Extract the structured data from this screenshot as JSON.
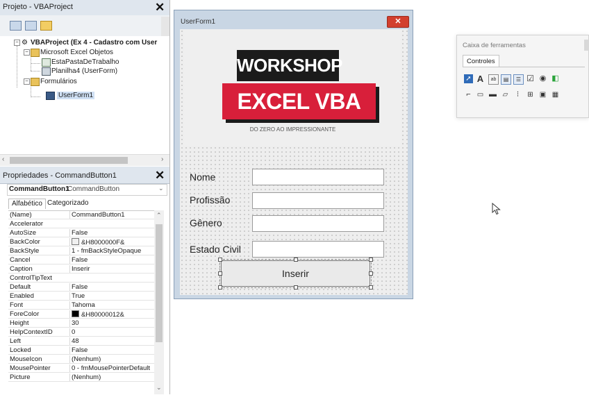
{
  "project_pane": {
    "title": "Projeto - VBAProject",
    "close_glyph": "✕",
    "tree": {
      "root": "VBAProject (Ex 4 - Cadastro com User",
      "excel_objects": "Microsoft Excel Objetos",
      "workbook": "EstaPastaDeTrabalho",
      "sheet": "Planilha4 (UserForm)",
      "forms_folder": "Formulários",
      "form": "UserForm1"
    }
  },
  "properties_pane": {
    "title": "Propriedades - CommandButton1",
    "close_glyph": "✕",
    "object_name": "CommandButton1",
    "object_type": "CommandButton",
    "tabs": [
      "Alfabético",
      "Categorizado"
    ],
    "rows": [
      {
        "name": "(Name)",
        "value": "CommandButton1"
      },
      {
        "name": "Accelerator",
        "value": ""
      },
      {
        "name": "AutoSize",
        "value": "False"
      },
      {
        "name": "BackColor",
        "value": "&H8000000F&",
        "swatch": "#f0f0f0"
      },
      {
        "name": "BackStyle",
        "value": "1 - fmBackStyleOpaque"
      },
      {
        "name": "Cancel",
        "value": "False"
      },
      {
        "name": "Caption",
        "value": "Inserir"
      },
      {
        "name": "ControlTipText",
        "value": ""
      },
      {
        "name": "Default",
        "value": "False"
      },
      {
        "name": "Enabled",
        "value": "True"
      },
      {
        "name": "Font",
        "value": "Tahoma"
      },
      {
        "name": "ForeColor",
        "value": "&H80000012&",
        "swatch": "#000000"
      },
      {
        "name": "Height",
        "value": "30"
      },
      {
        "name": "HelpContextID",
        "value": "0"
      },
      {
        "name": "Left",
        "value": "48"
      },
      {
        "name": "Locked",
        "value": "False"
      },
      {
        "name": "MouseIcon",
        "value": "(Nenhum)"
      },
      {
        "name": "MousePointer",
        "value": "0 - fmMousePointerDefault"
      },
      {
        "name": "Picture",
        "value": "(Nenhum)"
      }
    ]
  },
  "userform": {
    "title": "UserForm1",
    "close_glyph": "✕",
    "logo": {
      "line1": "WORKSHOP",
      "line2": "EXCEL VBA",
      "tagline": "DO ZERO AO IMPRESSIONANTE"
    },
    "fields": [
      {
        "label": "Nome",
        "value": ""
      },
      {
        "label": "Profissão",
        "value": ""
      },
      {
        "label": "Gênero",
        "value": ""
      },
      {
        "label": "Estado Civil",
        "value": ""
      }
    ],
    "insert_button": "Inserir"
  },
  "toolbox": {
    "title": "Caixa de ferramentas",
    "tab": "Controles"
  },
  "colors": {
    "logo_red": "#d81f3a",
    "logo_black": "#1b1b1b",
    "titlebar": "#dfe6ee",
    "form_close": "#d23f2e"
  }
}
